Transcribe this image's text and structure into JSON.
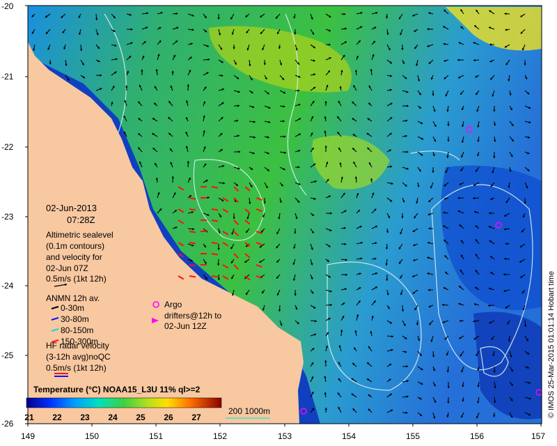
{
  "map": {
    "x_ticks": [
      "149",
      "150",
      "151",
      "152",
      "153",
      "154",
      "155",
      "156",
      "157"
    ],
    "y_ticks": [
      "-20",
      "-21",
      "-22",
      "-23",
      "-24",
      "-25",
      "-26"
    ],
    "date_line1": "02-Jun-2013",
    "date_line2": "07:28Z",
    "altimetry_lines": [
      "Altimetric sealevel",
      "(0.1m contours)",
      "and velocity for",
      "02-Jun 07Z",
      "0.5m/s (1kt 12h)"
    ],
    "anmn_title": "ANMN 12h av.",
    "anmn_items": [
      {
        "label": "0-30m",
        "color": "#000000"
      },
      {
        "label": "30-80m",
        "color": "#1010ff"
      },
      {
        "label": "80-150m",
        "color": "#00e0e0"
      },
      {
        "label": "150-300m",
        "color": "#ff1010"
      }
    ],
    "argo_line1": "Argo",
    "argo_line2": "drifters@12h to",
    "argo_line3": "02-Jun 12Z",
    "hf_lines": [
      "HF radar velocity",
      "(3-12h avg)noQC",
      "0.5m/s (1kt 12h)"
    ],
    "cbar_title": "Temperature (°C) NOAA15_L3U 11% ql>=2",
    "cbar_ticks": [
      "21",
      "22",
      "23",
      "24",
      "25",
      "26",
      "27"
    ],
    "depth_label": "200  1000m",
    "credit": "© IMOS 25-Mar-2015 01:01:14 Hobart time",
    "colors": {
      "land": "#f8c8a0",
      "warm_green": "#40c040",
      "argo_marker": "#ff00ff",
      "contour": "#d8f0f0"
    }
  }
}
